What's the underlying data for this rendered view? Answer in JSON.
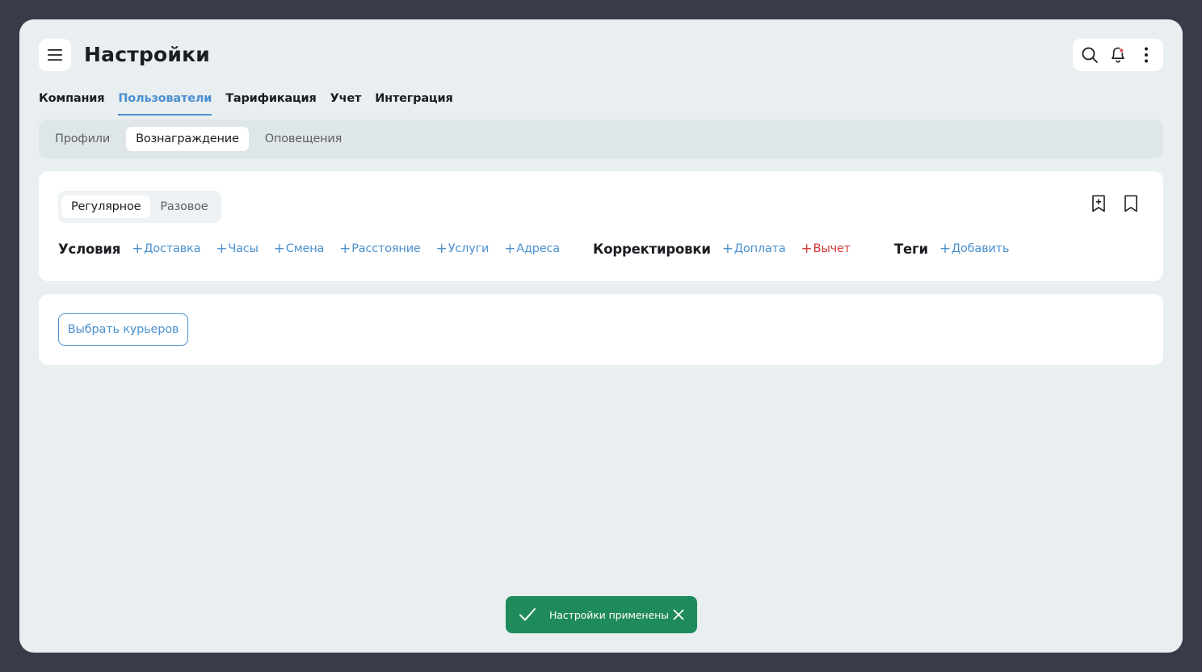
{
  "header": {
    "title": "Настройки",
    "menu_icon": "hamburger-menu-icon",
    "actions": [
      "search-icon",
      "notification-bell-icon",
      "more-vertical-icon"
    ],
    "notification_dot_color": "#e05050"
  },
  "main_tabs": [
    {
      "label": "Компания",
      "active": false
    },
    {
      "label": "Пользователи",
      "active": true
    },
    {
      "label": "Тарификация",
      "active": false
    },
    {
      "label": "Учет",
      "active": false
    },
    {
      "label": "Интеграция",
      "active": false
    }
  ],
  "sub_tabs": [
    {
      "label": "Профили",
      "active": false
    },
    {
      "label": "Вознаграждение",
      "active": true
    },
    {
      "label": "Оповещения",
      "active": false
    }
  ],
  "reward_type": {
    "options": [
      {
        "label": "Регулярное",
        "active": true
      },
      {
        "label": "Разовое",
        "active": false
      }
    ]
  },
  "bookmark_icons": [
    "bookmark-add-icon",
    "bookmark-icon"
  ],
  "conditions": {
    "title": "Условия",
    "items": [
      "Доставка",
      "Часы",
      "Смена",
      "Расстояние",
      "Услуги",
      "Адреса"
    ]
  },
  "adjustments": {
    "title": "Корректировки",
    "items": [
      {
        "label": "Доплата",
        "color": "#4a90d0"
      },
      {
        "label": "Вычет",
        "color": "#d63a3a"
      }
    ]
  },
  "tags": {
    "title": "Теги",
    "add_label": "Добавить"
  },
  "select_couriers_button": "Выбрать курьеров",
  "toast": {
    "message": "Настройки применены",
    "background": "#1f8a5b"
  },
  "colors": {
    "accent": "#4a90d0",
    "danger": "#d63a3a",
    "window_bg": "#e9eef0",
    "outer_bg": "#393a4a"
  }
}
